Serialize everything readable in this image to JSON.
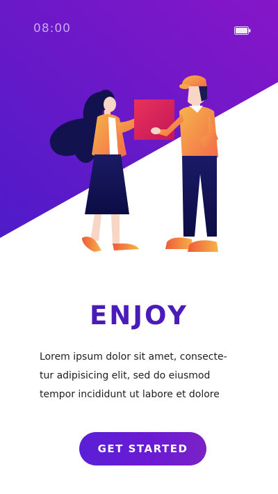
{
  "status_bar": {
    "time": "08:00",
    "battery_icon": "battery-icon"
  },
  "hero": {
    "illustration": "courier-delivering-package-illustration",
    "gradient_start": "#5a18d0",
    "gradient_end": "#8a16c8"
  },
  "content": {
    "title": "ENJOY",
    "description_lines": [
      "Lorem ipsum dolor sit amet, consecte-",
      "tur adipisicing elit, sed do eiusmod",
      "tempor incididunt ut labore et dolore"
    ]
  },
  "cta": {
    "label": "GET STARTED"
  },
  "colors": {
    "accent": "#4a1bb8",
    "button_start": "#5a1fd6",
    "button_end": "#7b22c6"
  }
}
